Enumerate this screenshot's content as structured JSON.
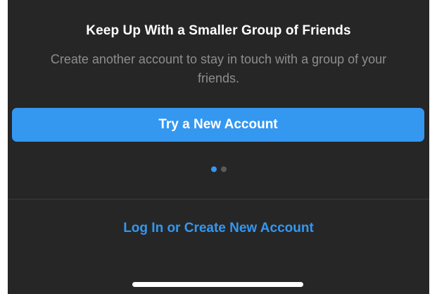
{
  "promo": {
    "title": "Keep Up With a Smaller Group of Friends",
    "subtitle": "Create another account to stay in touch with a group of your friends.",
    "primary_button_label": "Try a New Account"
  },
  "pager": {
    "total": 2,
    "active_index": 0
  },
  "footer": {
    "login_link_label": "Log In or Create New Account"
  },
  "colors": {
    "background": "#262626",
    "accent": "#3497f0",
    "title_text": "#ffffff",
    "subtitle_text": "#8e8e8e",
    "inactive_dot": "#5a5a5a"
  }
}
